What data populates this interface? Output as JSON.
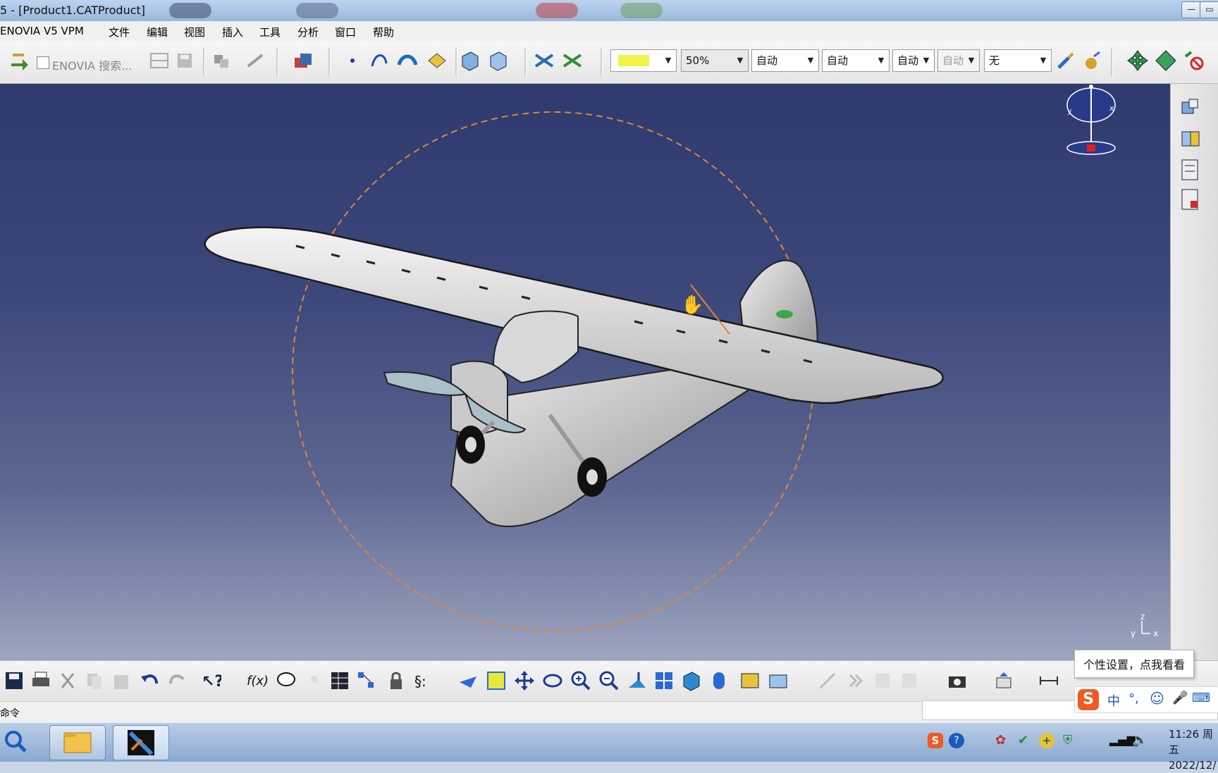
{
  "window": {
    "title": "5 - [Product1.CATProduct]"
  },
  "menu": [
    "ENOVIA V5 VPM",
    "文件",
    "编辑",
    "视图",
    "插入",
    "工具",
    "分析",
    "窗口",
    "帮助"
  ],
  "toolbar": {
    "enovia_search_label": "ENOVIA 搜索...",
    "color_swatch": "#f2f24a",
    "transparency": "50%",
    "line_thickness": "自动",
    "line_type": "自动",
    "point_type": "自动",
    "point_type_2": "自动",
    "layer": "无"
  },
  "status": {
    "command_label": "命令"
  },
  "tooltip": {
    "text": "个性设置，点我看看"
  },
  "ime": {
    "mode": "中"
  },
  "compass_axes": {
    "x": "x",
    "y": "y",
    "z": "z"
  },
  "clock": {
    "time": "11:26 周五",
    "date": "2022/12/"
  },
  "colors": {
    "viewport_top": "#2f3a6e",
    "viewport_bottom": "#9ea5c0",
    "selection_circle": "#e0843a"
  }
}
